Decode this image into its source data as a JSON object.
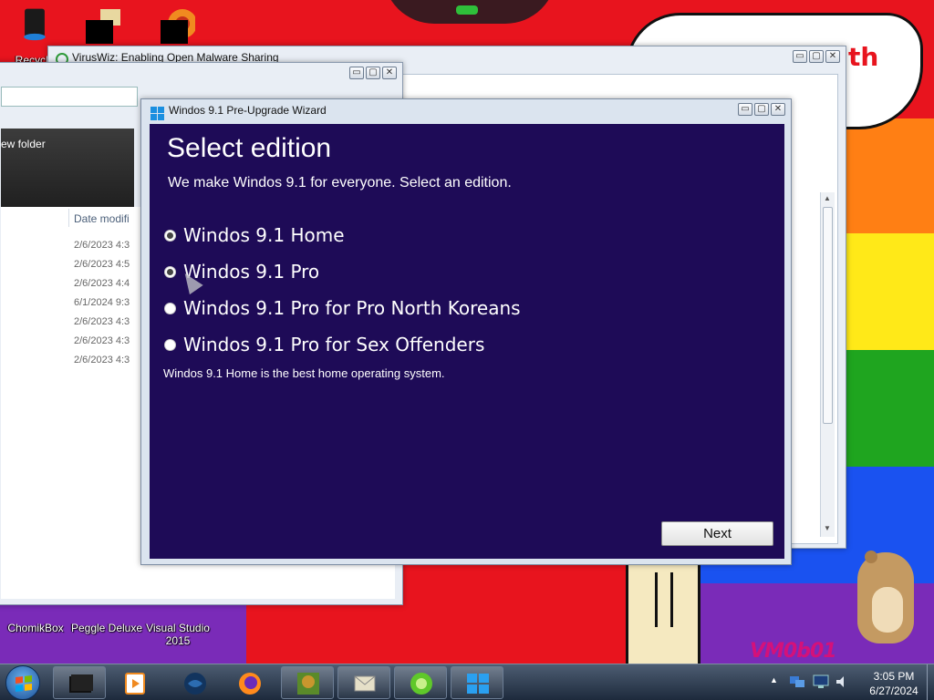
{
  "desktop": {
    "wallpaper_colors": {
      "red": "#e8141e",
      "orange": "#ff7f14",
      "yellow": "#ffe918",
      "green": "#1fa51f",
      "blue": "#1a52f0",
      "purple": "#7a2bb8",
      "cloud": "#ffffff"
    },
    "cloud_text": "th",
    "watermark": "VM0b01",
    "icons": [
      {
        "name": "Recycle",
        "icon": "recycle-bin-icon"
      },
      {
        "name": "",
        "icon": "black-folder-icon"
      },
      {
        "name": "",
        "icon": "media-player-icon"
      },
      {
        "name": "ChomikBox",
        "icon": "chomikbox-icon"
      },
      {
        "name": "Peggle Deluxe",
        "icon": "peggle-icon"
      },
      {
        "name": "Visual Studio 2015",
        "icon": "visual-studio-icon"
      }
    ]
  },
  "explorer": {
    "toolbar_label": "ew folder",
    "column_date": "Date modifi",
    "dates": [
      "2/6/2023 4:3",
      "2/6/2023 4:5",
      "2/6/2023 4:4",
      "6/1/2024 9:3",
      "2/6/2023 4:3",
      "2/6/2023 4:3",
      "2/6/2023 4:3"
    ]
  },
  "viruswiz": {
    "title": "VirusWiz: Enabling Open Malware Sharing"
  },
  "wizard": {
    "title": "Windos 9.1 Pre-Upgrade Wizard",
    "heading": "Select edition",
    "subtitle": "We make Windos 9.1 for everyone. Select an edition.",
    "options": [
      {
        "label": "Windos 9.1 Home",
        "checked": true
      },
      {
        "label": "Windos 9.1 Pro",
        "checked": true
      },
      {
        "label": "Windos 9.1 Pro for Pro North Koreans",
        "checked": false
      },
      {
        "label": "Windos 9.1 Pro for Sex Offenders",
        "checked": false
      }
    ],
    "description": "Windos 9.1 Home is the best home operating system.",
    "next_label": "Next",
    "accent": "#1e0b57"
  },
  "window_controls": {
    "minimize": "▭",
    "maximize": "▢",
    "close": "✕"
  },
  "taskbar": {
    "items": [
      "terminal-icon",
      "media-player-icon",
      "globe-icon",
      "firefox-icon",
      "game-box-icon",
      "mail-icon",
      "lime-icon",
      "windows-logo-icon"
    ],
    "clock": {
      "time": "3:05 PM",
      "date": "6/27/2024"
    }
  }
}
